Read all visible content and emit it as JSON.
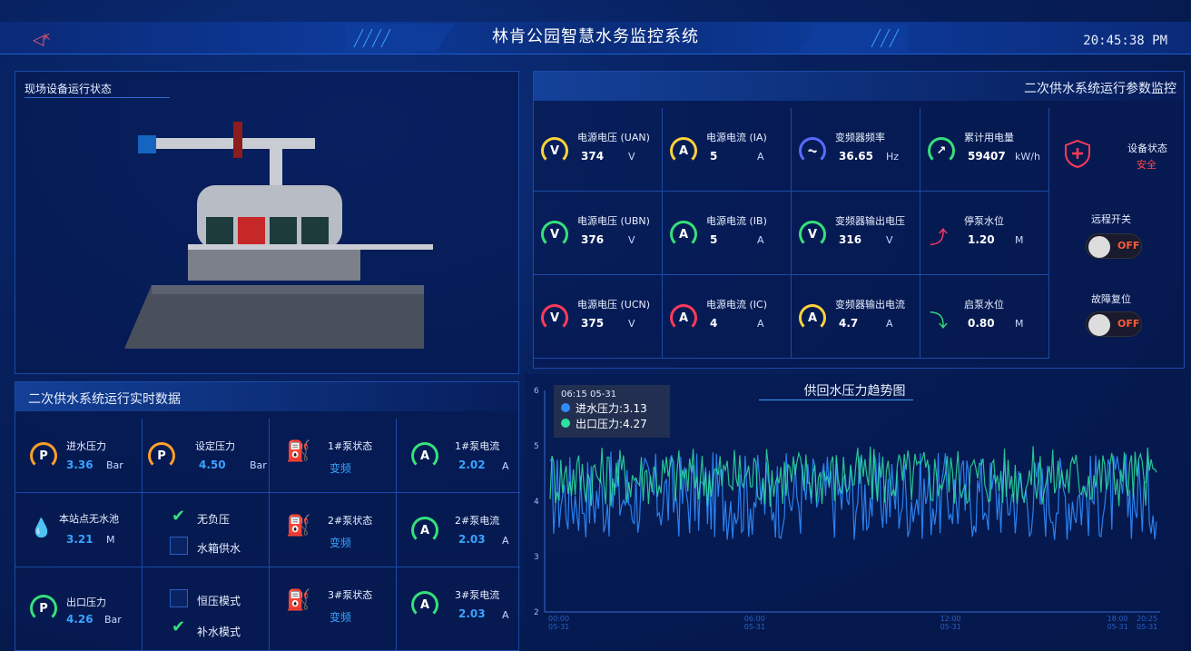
{
  "header": {
    "title": "林肯公园智慧水务监控系统",
    "clock": "20:45:38 PM"
  },
  "left_panel": {
    "title": "现场设备运行状态"
  },
  "params_panel": {
    "title": "二次供水系统运行参数监控",
    "cells": [
      {
        "label": "电源电压 (UAN)",
        "value": "374",
        "unit": "V",
        "icon": "V",
        "color": "#ffd23a"
      },
      {
        "label": "电源电流 (IA)",
        "value": "5",
        "unit": "A",
        "icon": "A",
        "color": "#ffd23a"
      },
      {
        "label": "变频器频率",
        "value": "36.65",
        "unit": "Hz",
        "icon": "~",
        "color": "#5a6aff"
      },
      {
        "label": "累计用电量",
        "value": "59407",
        "unit": "kW/h",
        "icon": "gauge",
        "color": "#35e07a"
      },
      {
        "label": "电源电压 (UBN)",
        "value": "376",
        "unit": "V",
        "icon": "V",
        "color": "#35e07a"
      },
      {
        "label": "电源电流 (IB)",
        "value": "5",
        "unit": "A",
        "icon": "A",
        "color": "#35e07a"
      },
      {
        "label": "变频器输出电压",
        "value": "316",
        "unit": "V",
        "icon": "V",
        "color": "#35e07a"
      },
      {
        "label": "停泵水位",
        "value": "1.20",
        "unit": "M",
        "icon": "trend-up",
        "color": "#ff3a6a"
      },
      {
        "label": "电源电压 (UCN)",
        "value": "375",
        "unit": "V",
        "icon": "V",
        "color": "#ff3a5a"
      },
      {
        "label": "电源电流 (IC)",
        "value": "4",
        "unit": "A",
        "icon": "A",
        "color": "#ff3a5a"
      },
      {
        "label": "变频器输出电流",
        "value": "4.7",
        "unit": "A",
        "icon": "A",
        "color": "#ffd23a"
      },
      {
        "label": "启泵水位",
        "value": "0.80",
        "unit": "M",
        "icon": "trend-down",
        "color": "#35e07a"
      }
    ],
    "status_label": "设备状态",
    "status_value": "安全",
    "remote_label": "远程开关",
    "remote_value": "OFF",
    "reset_label": "故障复位",
    "reset_value": "OFF"
  },
  "realtime_panel": {
    "title": "二次供水系统运行实时数据",
    "inlet_label": "进水压力",
    "inlet_value": "3.36",
    "inlet_unit": "Bar",
    "set_label": "设定压力",
    "set_value": "4.50",
    "set_unit": "Bar",
    "pool_label": "本站点无水池",
    "pool_value": "3.21",
    "pool_unit": "M",
    "outlet_label": "出口压力",
    "outlet_value": "4.26",
    "outlet_unit": "Bar",
    "opt_no_neg": "无负压",
    "opt_tank": "水箱供水",
    "opt_const": "恒压模式",
    "opt_refill": "补水模式",
    "pumps": [
      {
        "status_label": "1#泵状态",
        "status": "变频",
        "cur_label": "1#泵电流",
        "cur": "2.02",
        "unit": "A"
      },
      {
        "status_label": "2#泵状态",
        "status": "变频",
        "cur_label": "2#泵电流",
        "cur": "2.03",
        "unit": "A"
      },
      {
        "status_label": "3#泵状态",
        "status": "变频",
        "cur_label": "3#泵电流",
        "cur": "2.03",
        "unit": "A"
      }
    ]
  },
  "chart_data": {
    "type": "line",
    "title": "供回水压力趋势图",
    "ylim": [
      2,
      6
    ],
    "yticks": [
      "2",
      "3",
      "4",
      "5",
      "6"
    ],
    "xticks": [
      "00:00\n05-31",
      "06:00\n05-31",
      "12:00\n05-31",
      "18:00\n05-31",
      "20:25\n05-31"
    ],
    "tooltip_time": "06:15 05-31",
    "series": [
      {
        "name": "进水压力",
        "color": "#2f8cff",
        "tooltip": "进水压力:3.13"
      },
      {
        "name": "出口压力",
        "color": "#2fe0a0",
        "tooltip": "出口压力:4.27"
      }
    ]
  }
}
